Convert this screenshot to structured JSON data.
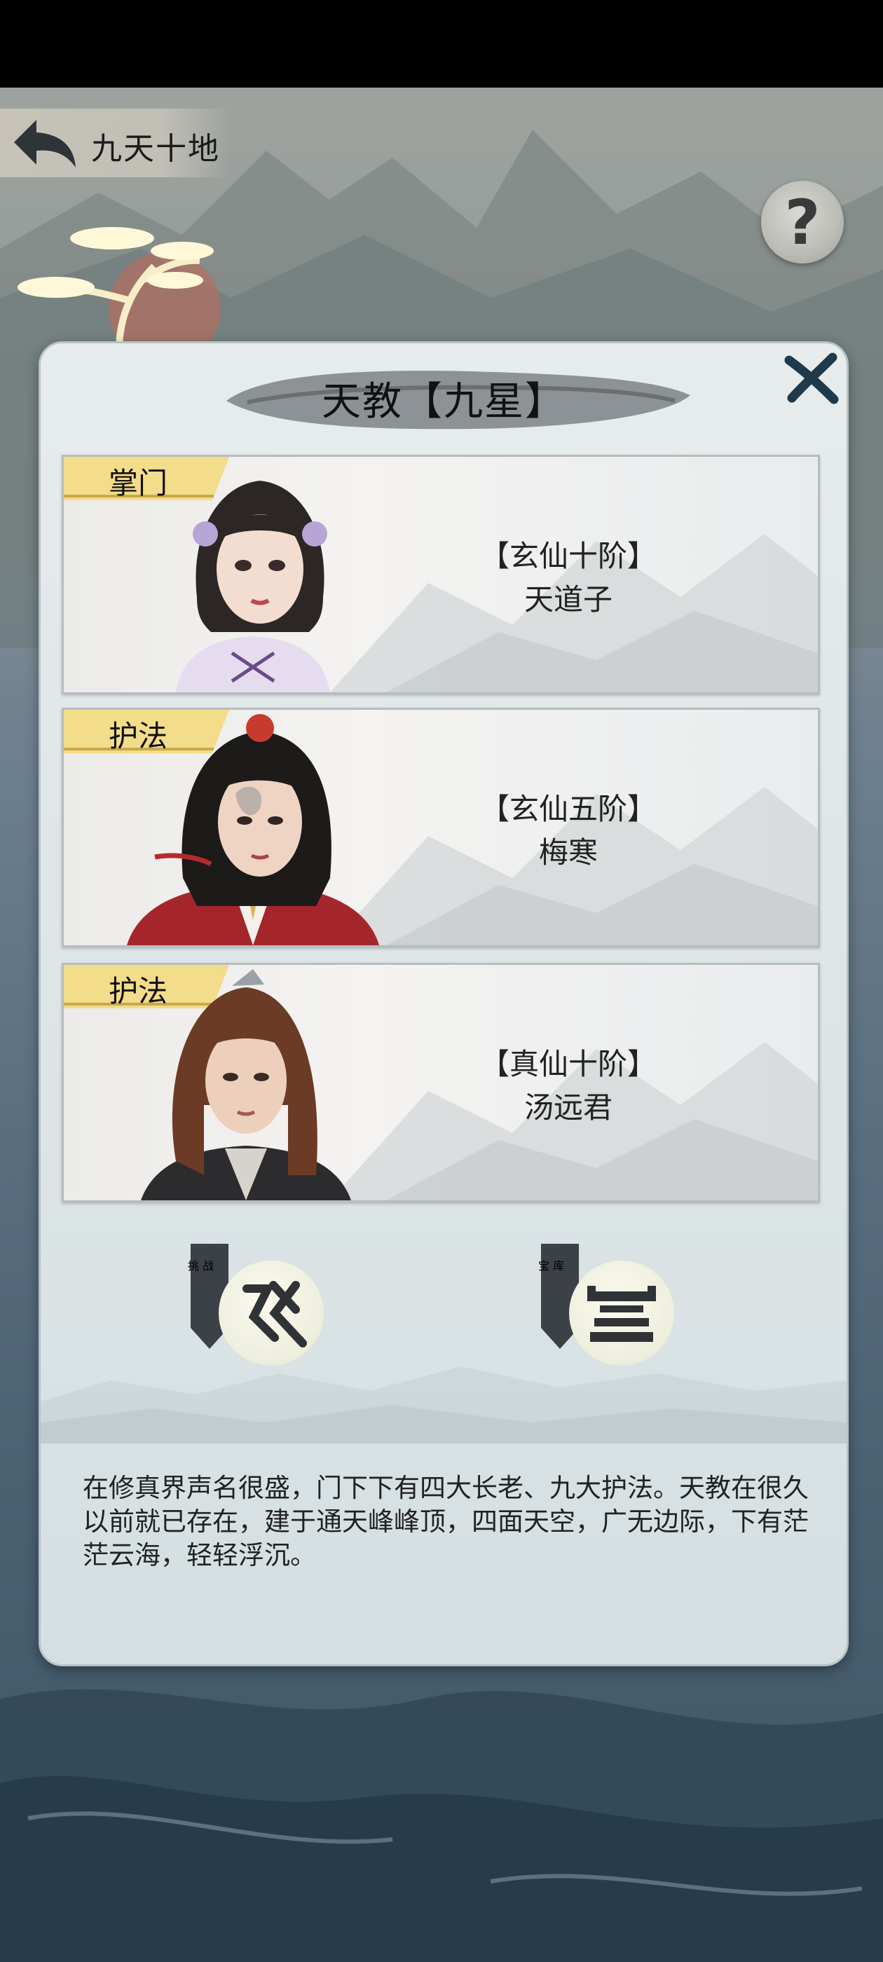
{
  "header": {
    "title": "九天十地",
    "help_symbol": "?"
  },
  "dialog": {
    "title": "天教【九星】",
    "members": [
      {
        "role": "掌门",
        "rank": "【玄仙十阶】",
        "name": "天道子"
      },
      {
        "role": "护法",
        "rank": "【玄仙五阶】",
        "name": "梅寒"
      },
      {
        "role": "护法",
        "rank": "【真仙十阶】",
        "name": "汤远君"
      }
    ],
    "actions": [
      {
        "badge": [
          "挑",
          "战"
        ],
        "icon": "challenge-icon"
      },
      {
        "badge": [
          "宝",
          "库"
        ],
        "icon": "treasury-icon"
      }
    ],
    "description": "在修真界声名很盛，门下下有四大长老、九大护法。天教在很久以前就已存在，建于通天峰峰顶，四面天空，广无边际，下有茫茫云海，轻轻浮沉。"
  },
  "colors": {
    "tag_gold": "#f3dc8a",
    "badge_dark": "#3b4147",
    "ink": "#2f3336"
  }
}
